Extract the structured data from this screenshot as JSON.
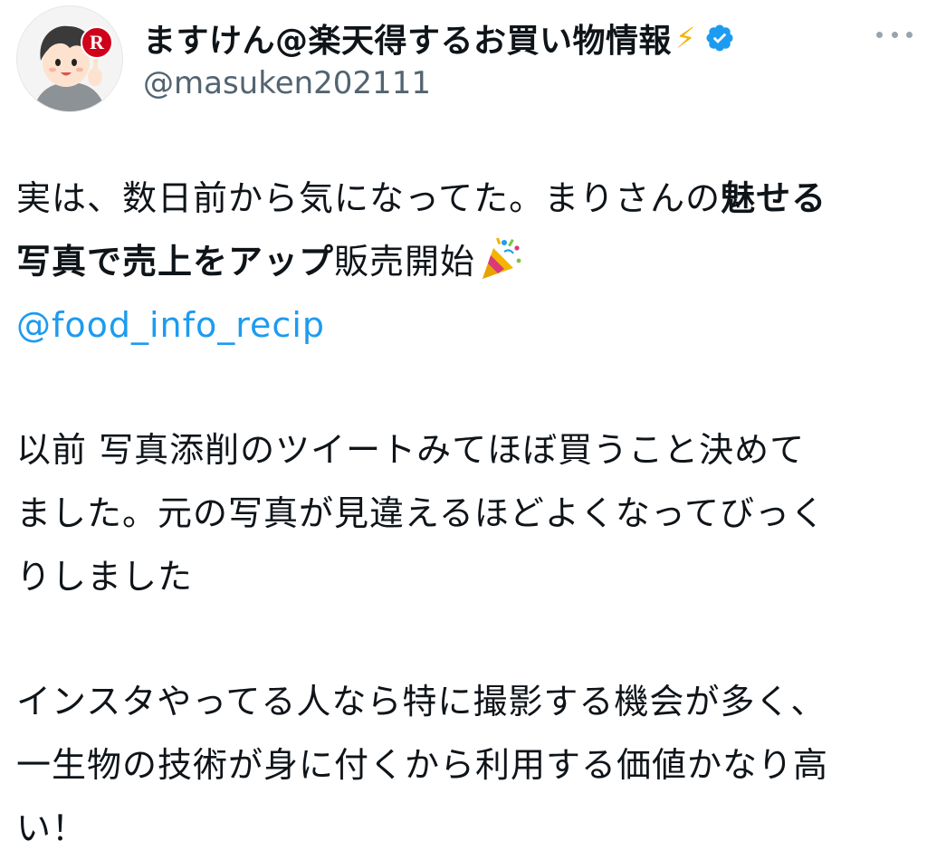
{
  "author": {
    "display_name": "ますけん@楽天得するお買い物情報",
    "name_emoji": "⚡",
    "handle": "@masuken202111",
    "verified": true,
    "avatar_badge_letter": "R"
  },
  "tweet": {
    "p1_a": "実は、数日前から気になってた。まりさんの",
    "p1_b": "魅せる",
    "p1_c": "写真で売上をアップ",
    "p1_d": "販売開始",
    "p1_emoji": "🎉",
    "mention": "@food_info_recip",
    "p2_l1": "以前 写真添削のツイートみてほぼ買うこと決めて",
    "p2_l2": "ました。元の写真が見違えるほどよくなってびっく",
    "p2_l3": "りしました",
    "p3_l1": "インスタやってる人なら特に撮影する機会が多く、",
    "p3_l2": "一生物の技術が身に付くから利用する価値かなり高",
    "p3_l3": "い！"
  },
  "colors": {
    "text": "#0f1419",
    "secondary": "#536471",
    "link": "#1d9bf0",
    "verified": "#1d9bf0",
    "avatar_badge": "#d0021b"
  },
  "icons": {
    "more": "more-icon",
    "verified": "verified-badge-icon",
    "emoji": "party-popper-icon"
  }
}
